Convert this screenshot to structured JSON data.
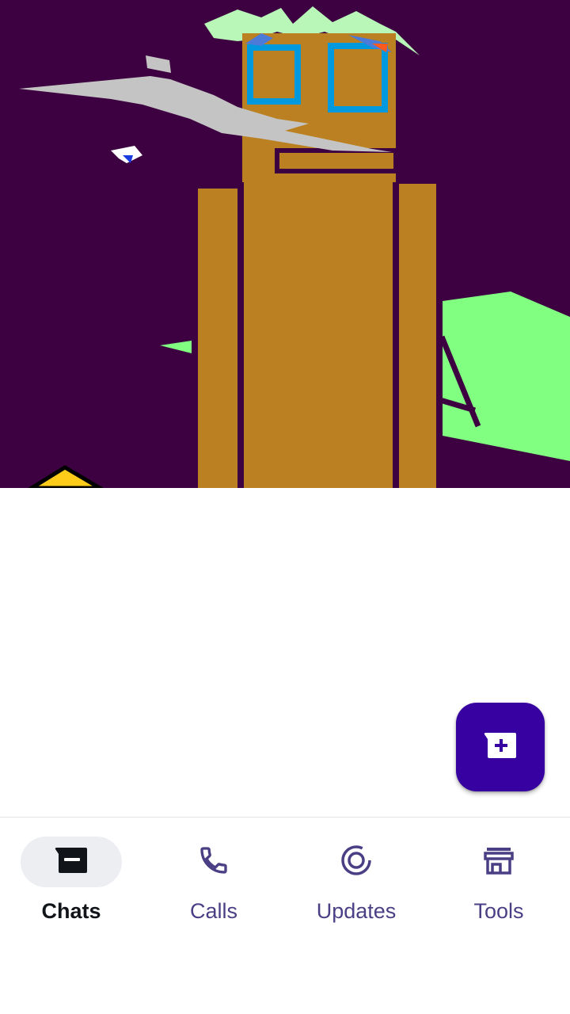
{
  "colors": {
    "accent": "#3700A0",
    "active_text": "#111418",
    "inactive": "#4A3F85",
    "active_indicator": "#ECEEF2",
    "banner_background": "#3D0040"
  },
  "banner": {
    "description_icon": "robot-drawing-image"
  },
  "fab": {
    "icon": "new-chat-icon"
  },
  "bottom_nav": {
    "items": [
      {
        "label": "Chats",
        "icon": "chats-icon",
        "active": true
      },
      {
        "label": "Calls",
        "icon": "phone-icon",
        "active": false
      },
      {
        "label": "Updates",
        "icon": "updates-icon",
        "active": false
      },
      {
        "label": "Tools",
        "icon": "store-icon",
        "active": false
      }
    ]
  }
}
